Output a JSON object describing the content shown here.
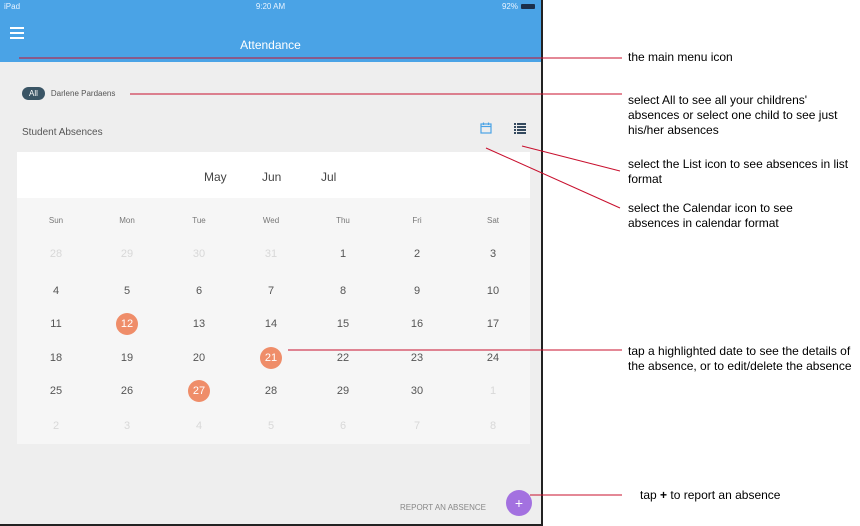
{
  "status_bar": {
    "carrier": "iPad",
    "time": "9:20 AM",
    "battery": "92%"
  },
  "nav": {
    "title": "Attendance",
    "menu_icon": "hamburger-menu-icon"
  },
  "filter": {
    "all_label": "All",
    "child_name": "Darlene Pardaens"
  },
  "section": {
    "title": "Student Absences",
    "calendar_icon": "calendar-icon",
    "list_icon": "list-icon"
  },
  "months": [
    "May",
    "Jun",
    "Jul"
  ],
  "weekdays": [
    "Sun",
    "Mon",
    "Tue",
    "Wed",
    "Thu",
    "Fri",
    "Sat"
  ],
  "calendar_rows": [
    [
      {
        "d": "28",
        "m": true
      },
      {
        "d": "29",
        "m": true
      },
      {
        "d": "30",
        "m": true
      },
      {
        "d": "31",
        "m": true
      },
      {
        "d": "1"
      },
      {
        "d": "2"
      },
      {
        "d": "3"
      }
    ],
    [
      {
        "d": "4"
      },
      {
        "d": "5"
      },
      {
        "d": "6"
      },
      {
        "d": "7"
      },
      {
        "d": "8"
      },
      {
        "d": "9"
      },
      {
        "d": "10"
      }
    ],
    [
      {
        "d": "11"
      },
      {
        "d": "12",
        "h": true
      },
      {
        "d": "13"
      },
      {
        "d": "14"
      },
      {
        "d": "15"
      },
      {
        "d": "16"
      },
      {
        "d": "17"
      }
    ],
    [
      {
        "d": "18"
      },
      {
        "d": "19"
      },
      {
        "d": "20"
      },
      {
        "d": "21",
        "h": true
      },
      {
        "d": "22"
      },
      {
        "d": "23"
      },
      {
        "d": "24"
      }
    ],
    [
      {
        "d": "25"
      },
      {
        "d": "26"
      },
      {
        "d": "27",
        "h": true
      },
      {
        "d": "28"
      },
      {
        "d": "29"
      },
      {
        "d": "30"
      },
      {
        "d": "1",
        "m": true
      }
    ],
    [
      {
        "d": "2",
        "m": true
      },
      {
        "d": "3",
        "m": true
      },
      {
        "d": "4",
        "m": true
      },
      {
        "d": "5",
        "m": true
      },
      {
        "d": "6",
        "m": true
      },
      {
        "d": "7",
        "m": true
      },
      {
        "d": "8",
        "m": true
      }
    ]
  ],
  "report": {
    "label": "REPORT AN ABSENCE",
    "fab_symbol": "+"
  },
  "colors": {
    "nav": "#4aa3e6",
    "highlight": "#ef8d69",
    "fab": "#a371e0",
    "annotation_line": "#c8102e"
  },
  "annotations": {
    "menu": "the main menu icon",
    "select_all": "select All to see all your childrens' absences or select one child to see just his/her absences",
    "list": "select the List icon to see absences in list format",
    "calendar": "select the Calendar icon to see absences in calendar format",
    "highlighted": "tap a highlighted date to see the details of the absence, or to edit/delete the absence",
    "report_prefix": "tap",
    "report_symbol": "+",
    "report_suffix": "to report an absence"
  }
}
